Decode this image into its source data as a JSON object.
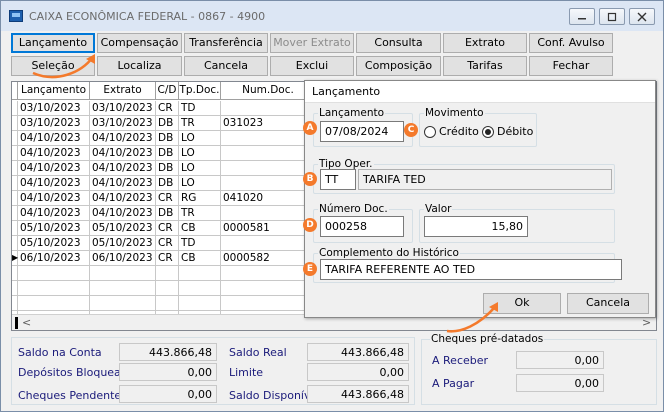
{
  "window": {
    "title": "CAIXA ECONÔMICA FEDERAL - 0867 - 4900",
    "controls": [
      "minimize-icon",
      "maximize-icon",
      "close-icon"
    ]
  },
  "toolbar": {
    "row1": [
      {
        "label": "Lançamento",
        "underline": "ç",
        "state": "focused"
      },
      {
        "label": "Compensação",
        "underline": "C",
        "state": "normal"
      },
      {
        "label": "Transferência",
        "underline": "T",
        "state": "normal"
      },
      {
        "label": "Mover Extrato",
        "underline": "v",
        "state": "disabled"
      },
      {
        "label": "Consulta",
        "underline": "C",
        "state": "normal"
      },
      {
        "label": "Extrato",
        "underline": "x",
        "state": "normal"
      },
      {
        "label": "Conf. Avulso",
        "underline": "v",
        "state": "normal"
      }
    ],
    "row2": [
      {
        "label": "Seleção",
        "underline": "S",
        "state": "normal"
      },
      {
        "label": "Localiza",
        "underline": "L",
        "state": "normal"
      },
      {
        "label": "Cancela",
        "underline": "C",
        "state": "normal"
      },
      {
        "label": "Exclui",
        "underline": "E",
        "state": "normal"
      },
      {
        "label": "Composição",
        "underline": "p",
        "state": "normal"
      },
      {
        "label": "Tarifas",
        "underline": "r",
        "state": "normal"
      },
      {
        "label": "Fechar",
        "underline": "r",
        "state": "normal"
      }
    ]
  },
  "grid": {
    "columns": [
      "Lançamento",
      "Extrato",
      "C/D",
      "Tp.Doc.",
      "Num.Doc."
    ],
    "rows": [
      [
        "03/10/2023",
        "03/10/2023",
        "CR",
        "TD",
        ""
      ],
      [
        "03/10/2023",
        "03/10/2023",
        "DB",
        "TR",
        "031023"
      ],
      [
        "04/10/2023",
        "04/10/2023",
        "DB",
        "LO",
        ""
      ],
      [
        "04/10/2023",
        "04/10/2023",
        "DB",
        "LO",
        ""
      ],
      [
        "04/10/2023",
        "04/10/2023",
        "DB",
        "LO",
        ""
      ],
      [
        "04/10/2023",
        "04/10/2023",
        "DB",
        "LO",
        ""
      ],
      [
        "04/10/2023",
        "04/10/2023",
        "CR",
        "RG",
        "041020"
      ],
      [
        "04/10/2023",
        "04/10/2023",
        "DB",
        "TR",
        ""
      ],
      [
        "05/10/2023",
        "05/10/2023",
        "CR",
        "CB",
        "0000581"
      ],
      [
        "05/10/2023",
        "05/10/2023",
        "CR",
        "TD",
        ""
      ],
      [
        "06/10/2023",
        "06/10/2023",
        "CR",
        "CB",
        "0000582"
      ]
    ],
    "current_row_marker": "▶"
  },
  "summary": {
    "saldo_conta_label": "Saldo na Conta",
    "saldo_conta": "443.866,48",
    "depositos_label": "Depósitos Bloqueados",
    "depositos": "0,00",
    "cheques_pend_label": "Cheques Pendentes",
    "cheques_pend": "0,00",
    "saldo_real_label": "Saldo Real",
    "saldo_real": "443.866,48",
    "limite_label": "Limite",
    "limite": "0,00",
    "saldo_disp_label": "Saldo Disponível",
    "saldo_disp": "443.866,48",
    "predatados_title": "Cheques pré-datados",
    "a_receber_label": "A Receber",
    "a_receber": "0,00",
    "a_pagar_label": "A Pagar",
    "a_pagar": "0,00"
  },
  "dialog": {
    "title": "Lançamento",
    "lancamento_label": "Lançamento",
    "lancamento_value": "07/08/2024",
    "movimento_label": "Movimento",
    "credito_label": "Crédito",
    "debito_label": "Débito",
    "movimento_selected": "Débito",
    "tipo_oper_label": "Tipo Oper.",
    "tipo_oper_code": "TT",
    "tipo_oper_desc": "TARIFA TED",
    "numero_doc_label": "Número Doc.",
    "numero_doc_value": "000258",
    "valor_label": "Valor",
    "valor_value": "15,80",
    "complemento_label": "Complemento do Histórico",
    "complemento_value": "TARIFA REFERENTE AO TED",
    "ok_label": "Ok",
    "cancela_label": "Cancela"
  },
  "annotations": {
    "badges": [
      "A",
      "B",
      "C",
      "D",
      "E"
    ],
    "color": "#f47a2c"
  }
}
